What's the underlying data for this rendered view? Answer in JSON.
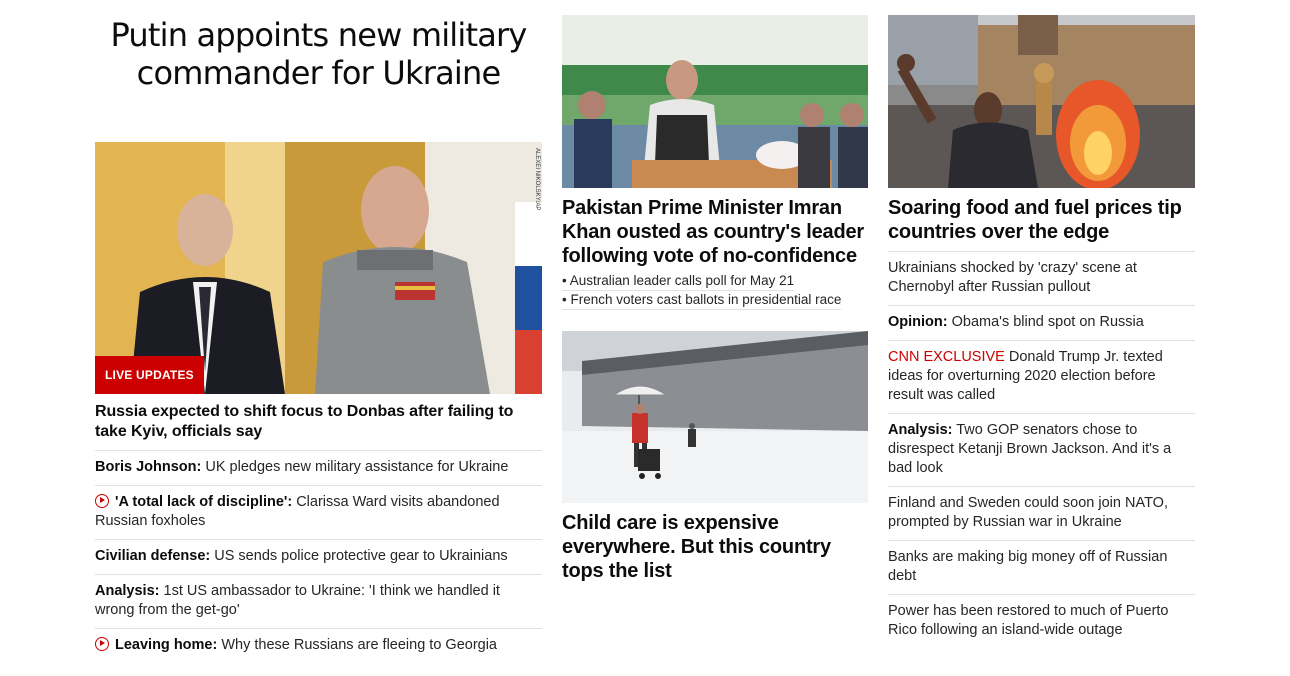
{
  "col1": {
    "headline": "Putin appoints new military commander for Ukraine",
    "image_badge": "LIVE UPDATES",
    "image_credit": "ALEXEI NIKOLSKY/AP",
    "lead_title": "Russia expected to shift focus to Donbas after failing to take Kyiv, officials say",
    "items": [
      {
        "prefix": "Boris Johnson:",
        "text": " UK pledges new military assistance for Ukraine",
        "video": false
      },
      {
        "prefix": "'A total lack of discipline':",
        "text": " Clarissa Ward visits abandoned Russian foxholes",
        "video": true
      },
      {
        "prefix": "Civilian defense:",
        "text": " US sends police protective gear to Ukrainians",
        "video": false
      },
      {
        "prefix": "Analysis:",
        "text": " 1st US ambassador to Ukraine: 'I think we handled it wrong from the get-go'",
        "video": false
      },
      {
        "prefix": "Leaving home:",
        "text": " Why these Russians are fleeing to Georgia",
        "video": true
      }
    ]
  },
  "col2": {
    "story1_title": "Pakistan Prime Minister Imran Khan ousted as country's leader following vote of no-confidence",
    "story1_links": [
      "• Australian leader calls poll for May 21",
      "• French voters cast ballots in presidential race"
    ],
    "story2_title": "Child care is expensive everywhere. But this country tops the list"
  },
  "col3": {
    "lead_title": "Soaring food and fuel prices tip countries over the edge",
    "items": [
      {
        "prefix": "",
        "text": "Ukrainians shocked by 'crazy' scene at Chernobyl after Russian pullout",
        "exclusive": false
      },
      {
        "prefix": "Opinion:",
        "text": " Obama's blind spot on Russia",
        "exclusive": false
      },
      {
        "prefix": "CNN EXCLUSIVE",
        "text": " Donald Trump Jr. texted ideas for overturning 2020 election before result was called",
        "exclusive": true
      },
      {
        "prefix": "Analysis:",
        "text": " Two GOP senators chose to disrespect Ketanji Brown Jackson. And it's a bad look",
        "exclusive": false
      },
      {
        "prefix": "",
        "text": "Finland and Sweden could soon join NATO, prompted by Russian war in Ukraine",
        "exclusive": false
      },
      {
        "prefix": "",
        "text": "Banks are making big money off of Russian debt",
        "exclusive": false
      },
      {
        "prefix": "",
        "text": "Power has been restored to much of Puerto Rico following an island-wide outage",
        "exclusive": false
      }
    ]
  },
  "colors": {
    "accent": "#cc0000",
    "divider": "#e0e0e0"
  }
}
